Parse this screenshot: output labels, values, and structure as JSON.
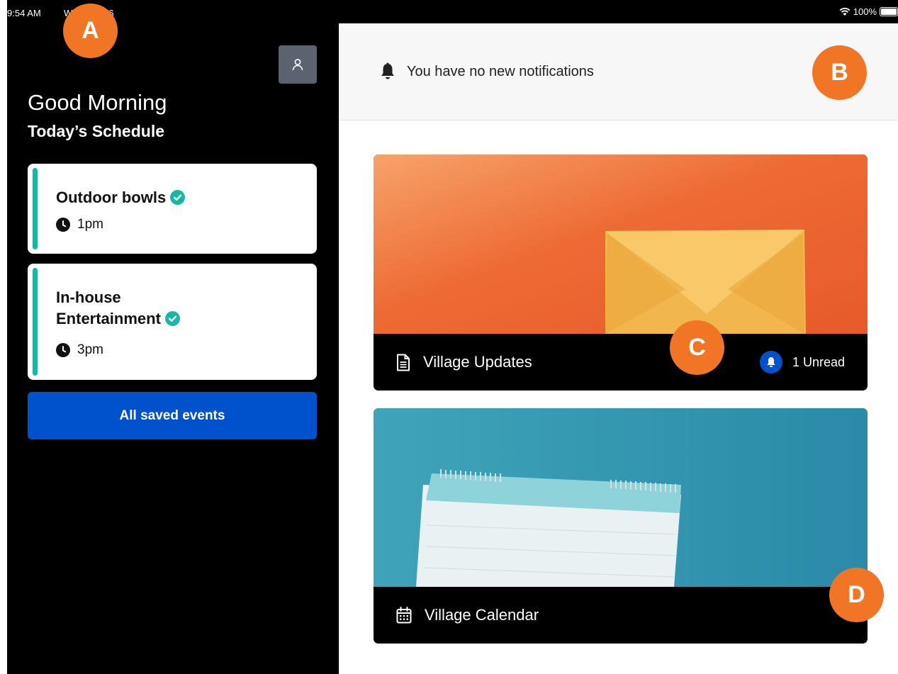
{
  "status_bar": {
    "time": "9:54 AM",
    "date": "Wed Mar 16",
    "battery": "100%"
  },
  "sidebar": {
    "greeting": "Good Morning",
    "subtitle": "Today’s Schedule",
    "events": [
      {
        "title": "Outdoor bowls",
        "time": "1pm",
        "saved": true
      },
      {
        "title": "In-house Entertainment",
        "time": "3pm",
        "saved": true
      }
    ],
    "all_events_label": "All saved events"
  },
  "notifications": {
    "message": "You have no new notifications"
  },
  "tiles": {
    "updates": {
      "label": "Village Updates",
      "unread_label": "1 Unread"
    },
    "calendar": {
      "label": "Village Calendar"
    }
  },
  "markers": [
    "A",
    "B",
    "C",
    "D"
  ],
  "colors": {
    "accent_teal": "#19b6a3",
    "primary_blue": "#0051cc",
    "marker_orange": "#f07626",
    "updates_orange": "#ee6a33",
    "calendar_teal": "#2f94ad"
  }
}
